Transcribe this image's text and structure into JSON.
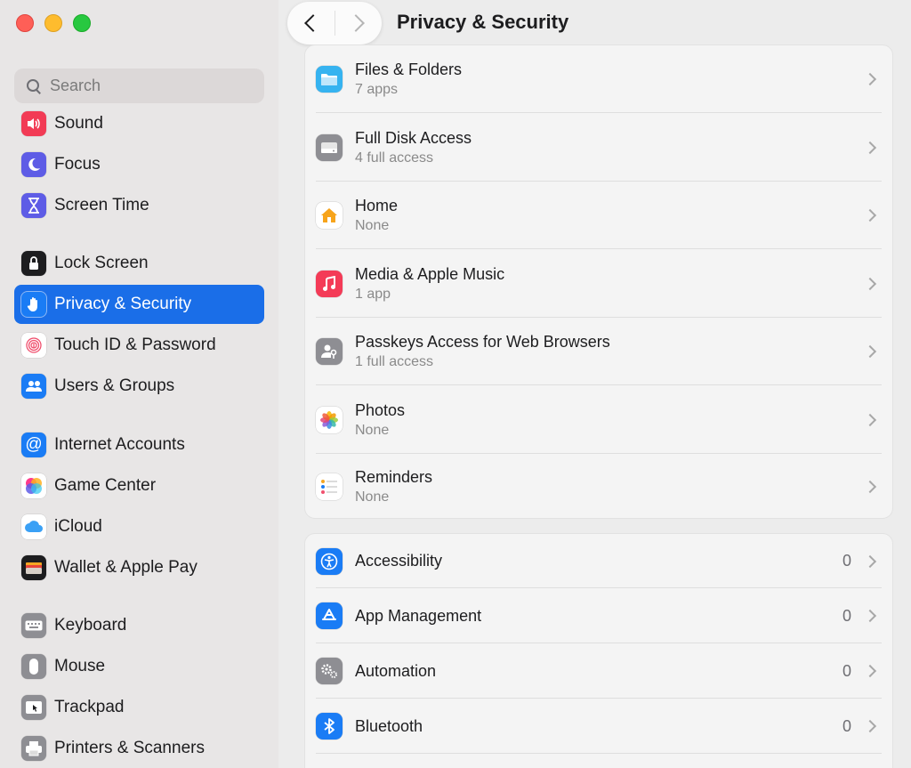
{
  "window": {
    "title": "Privacy & Security"
  },
  "search": {
    "placeholder": "Search"
  },
  "sidebar": {
    "items": [
      {
        "label": "Sound",
        "icon": "speaker-icon",
        "color": "#f23b55"
      },
      {
        "label": "Focus",
        "icon": "moon-icon",
        "color": "#5e5ce6"
      },
      {
        "label": "Screen Time",
        "icon": "hourglass-icon",
        "color": "#5e5ce6"
      },
      {
        "label": "Lock Screen",
        "icon": "lock-icon",
        "color": "#1d1d1f"
      },
      {
        "label": "Privacy & Security",
        "icon": "hand-icon",
        "color": "#1a7cf5",
        "selected": true
      },
      {
        "label": "Touch ID & Password",
        "icon": "fingerprint-icon",
        "color": "#ffffff"
      },
      {
        "label": "Users & Groups",
        "icon": "users-icon",
        "color": "#1a7cf5"
      },
      {
        "label": "Internet Accounts",
        "icon": "at-icon",
        "color": "#1a7cf5"
      },
      {
        "label": "Game Center",
        "icon": "game-center-icon",
        "color": "#ffffff"
      },
      {
        "label": "iCloud",
        "icon": "cloud-icon",
        "color": "#ffffff"
      },
      {
        "label": "Wallet & Apple Pay",
        "icon": "wallet-icon",
        "color": "#1d1d1f"
      },
      {
        "label": "Keyboard",
        "icon": "keyboard-icon",
        "color": "#8e8e93"
      },
      {
        "label": "Mouse",
        "icon": "mouse-icon",
        "color": "#8e8e93"
      },
      {
        "label": "Trackpad",
        "icon": "trackpad-icon",
        "color": "#8e8e93"
      },
      {
        "label": "Printers & Scanners",
        "icon": "printer-icon",
        "color": "#8e8e93"
      }
    ]
  },
  "access_group": {
    "rows": [
      {
        "title": "Files & Folders",
        "sub": "7 apps",
        "icon": "folder-icon",
        "color": "#36b3f0"
      },
      {
        "title": "Full Disk Access",
        "sub": "4 full access",
        "icon": "disk-icon",
        "color": "#8e8e93"
      },
      {
        "title": "Home",
        "sub": "None",
        "icon": "home-icon",
        "color": "#ffffff"
      },
      {
        "title": "Media & Apple Music",
        "sub": "1 app",
        "icon": "music-icon",
        "color": "#f43b57"
      },
      {
        "title": "Passkeys Access for Web Browsers",
        "sub": "1 full access",
        "icon": "passkey-icon",
        "color": "#8e8e93"
      },
      {
        "title": "Photos",
        "sub": "None",
        "icon": "photos-icon",
        "color": "#ffffff"
      },
      {
        "title": "Reminders",
        "sub": "None",
        "icon": "reminders-icon",
        "color": "#ffffff"
      }
    ]
  },
  "permission_group": {
    "rows": [
      {
        "title": "Accessibility",
        "count": "0",
        "icon": "accessibility-icon",
        "color": "#1a7cf5"
      },
      {
        "title": "App Management",
        "count": "0",
        "icon": "app-store-icon",
        "color": "#1a7cf5"
      },
      {
        "title": "Automation",
        "count": "0",
        "icon": "gears-icon",
        "color": "#8e8e93"
      },
      {
        "title": "Bluetooth",
        "count": "0",
        "icon": "bluetooth-icon",
        "color": "#1a7cf5"
      }
    ]
  }
}
